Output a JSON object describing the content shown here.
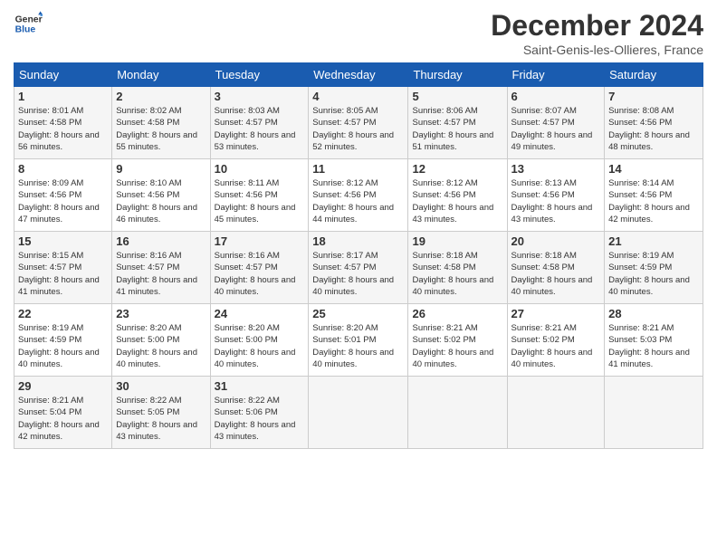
{
  "header": {
    "logo_general": "General",
    "logo_blue": "Blue",
    "month_title": "December 2024",
    "subtitle": "Saint-Genis-les-Ollieres, France"
  },
  "weekdays": [
    "Sunday",
    "Monday",
    "Tuesday",
    "Wednesday",
    "Thursday",
    "Friday",
    "Saturday"
  ],
  "weeks": [
    [
      {
        "day": "1",
        "sunrise": "8:01 AM",
        "sunset": "4:58 PM",
        "daylight": "8 hours and 56 minutes."
      },
      {
        "day": "2",
        "sunrise": "8:02 AM",
        "sunset": "4:58 PM",
        "daylight": "8 hours and 55 minutes."
      },
      {
        "day": "3",
        "sunrise": "8:03 AM",
        "sunset": "4:57 PM",
        "daylight": "8 hours and 53 minutes."
      },
      {
        "day": "4",
        "sunrise": "8:05 AM",
        "sunset": "4:57 PM",
        "daylight": "8 hours and 52 minutes."
      },
      {
        "day": "5",
        "sunrise": "8:06 AM",
        "sunset": "4:57 PM",
        "daylight": "8 hours and 51 minutes."
      },
      {
        "day": "6",
        "sunrise": "8:07 AM",
        "sunset": "4:57 PM",
        "daylight": "8 hours and 49 minutes."
      },
      {
        "day": "7",
        "sunrise": "8:08 AM",
        "sunset": "4:56 PM",
        "daylight": "8 hours and 48 minutes."
      }
    ],
    [
      {
        "day": "8",
        "sunrise": "8:09 AM",
        "sunset": "4:56 PM",
        "daylight": "8 hours and 47 minutes."
      },
      {
        "day": "9",
        "sunrise": "8:10 AM",
        "sunset": "4:56 PM",
        "daylight": "8 hours and 46 minutes."
      },
      {
        "day": "10",
        "sunrise": "8:11 AM",
        "sunset": "4:56 PM",
        "daylight": "8 hours and 45 minutes."
      },
      {
        "day": "11",
        "sunrise": "8:12 AM",
        "sunset": "4:56 PM",
        "daylight": "8 hours and 44 minutes."
      },
      {
        "day": "12",
        "sunrise": "8:12 AM",
        "sunset": "4:56 PM",
        "daylight": "8 hours and 43 minutes."
      },
      {
        "day": "13",
        "sunrise": "8:13 AM",
        "sunset": "4:56 PM",
        "daylight": "8 hours and 43 minutes."
      },
      {
        "day": "14",
        "sunrise": "8:14 AM",
        "sunset": "4:56 PM",
        "daylight": "8 hours and 42 minutes."
      }
    ],
    [
      {
        "day": "15",
        "sunrise": "8:15 AM",
        "sunset": "4:57 PM",
        "daylight": "8 hours and 41 minutes."
      },
      {
        "day": "16",
        "sunrise": "8:16 AM",
        "sunset": "4:57 PM",
        "daylight": "8 hours and 41 minutes."
      },
      {
        "day": "17",
        "sunrise": "8:16 AM",
        "sunset": "4:57 PM",
        "daylight": "8 hours and 40 minutes."
      },
      {
        "day": "18",
        "sunrise": "8:17 AM",
        "sunset": "4:57 PM",
        "daylight": "8 hours and 40 minutes."
      },
      {
        "day": "19",
        "sunrise": "8:18 AM",
        "sunset": "4:58 PM",
        "daylight": "8 hours and 40 minutes."
      },
      {
        "day": "20",
        "sunrise": "8:18 AM",
        "sunset": "4:58 PM",
        "daylight": "8 hours and 40 minutes."
      },
      {
        "day": "21",
        "sunrise": "8:19 AM",
        "sunset": "4:59 PM",
        "daylight": "8 hours and 40 minutes."
      }
    ],
    [
      {
        "day": "22",
        "sunrise": "8:19 AM",
        "sunset": "4:59 PM",
        "daylight": "8 hours and 40 minutes."
      },
      {
        "day": "23",
        "sunrise": "8:20 AM",
        "sunset": "5:00 PM",
        "daylight": "8 hours and 40 minutes."
      },
      {
        "day": "24",
        "sunrise": "8:20 AM",
        "sunset": "5:00 PM",
        "daylight": "8 hours and 40 minutes."
      },
      {
        "day": "25",
        "sunrise": "8:20 AM",
        "sunset": "5:01 PM",
        "daylight": "8 hours and 40 minutes."
      },
      {
        "day": "26",
        "sunrise": "8:21 AM",
        "sunset": "5:02 PM",
        "daylight": "8 hours and 40 minutes."
      },
      {
        "day": "27",
        "sunrise": "8:21 AM",
        "sunset": "5:02 PM",
        "daylight": "8 hours and 40 minutes."
      },
      {
        "day": "28",
        "sunrise": "8:21 AM",
        "sunset": "5:03 PM",
        "daylight": "8 hours and 41 minutes."
      }
    ],
    [
      {
        "day": "29",
        "sunrise": "8:21 AM",
        "sunset": "5:04 PM",
        "daylight": "8 hours and 42 minutes."
      },
      {
        "day": "30",
        "sunrise": "8:22 AM",
        "sunset": "5:05 PM",
        "daylight": "8 hours and 43 minutes."
      },
      {
        "day": "31",
        "sunrise": "8:22 AM",
        "sunset": "5:06 PM",
        "daylight": "8 hours and 43 minutes."
      },
      null,
      null,
      null,
      null
    ]
  ]
}
